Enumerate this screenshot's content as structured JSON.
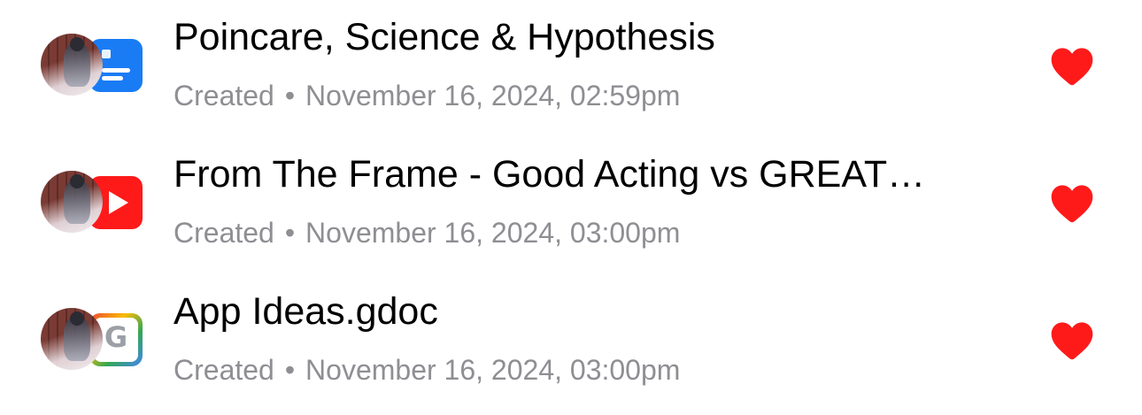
{
  "items": [
    {
      "title": "Poincare, Science & Hypothesis",
      "status": "Created",
      "separator": "•",
      "date": "November 16, 2024, 02:59pm",
      "app_icon": "document-icon",
      "favorited": true
    },
    {
      "title": "From The Frame - Good Acting vs GREAT…",
      "status": "Created",
      "separator": "•",
      "date": "November 16, 2024, 03:00pm",
      "app_icon": "youtube-icon",
      "favorited": true
    },
    {
      "title": "App Ideas.gdoc",
      "status": "Created",
      "separator": "•",
      "date": "November 16, 2024, 03:00pm",
      "app_icon": "google-docs-icon",
      "badge_letter": "G",
      "favorited": true
    }
  ],
  "colors": {
    "heart": "#ff1a1a",
    "meta_text": "#8e8e93",
    "title_text": "#000000",
    "doc_badge": "#1a7cf5",
    "youtube_badge": "#ff1a1a"
  }
}
